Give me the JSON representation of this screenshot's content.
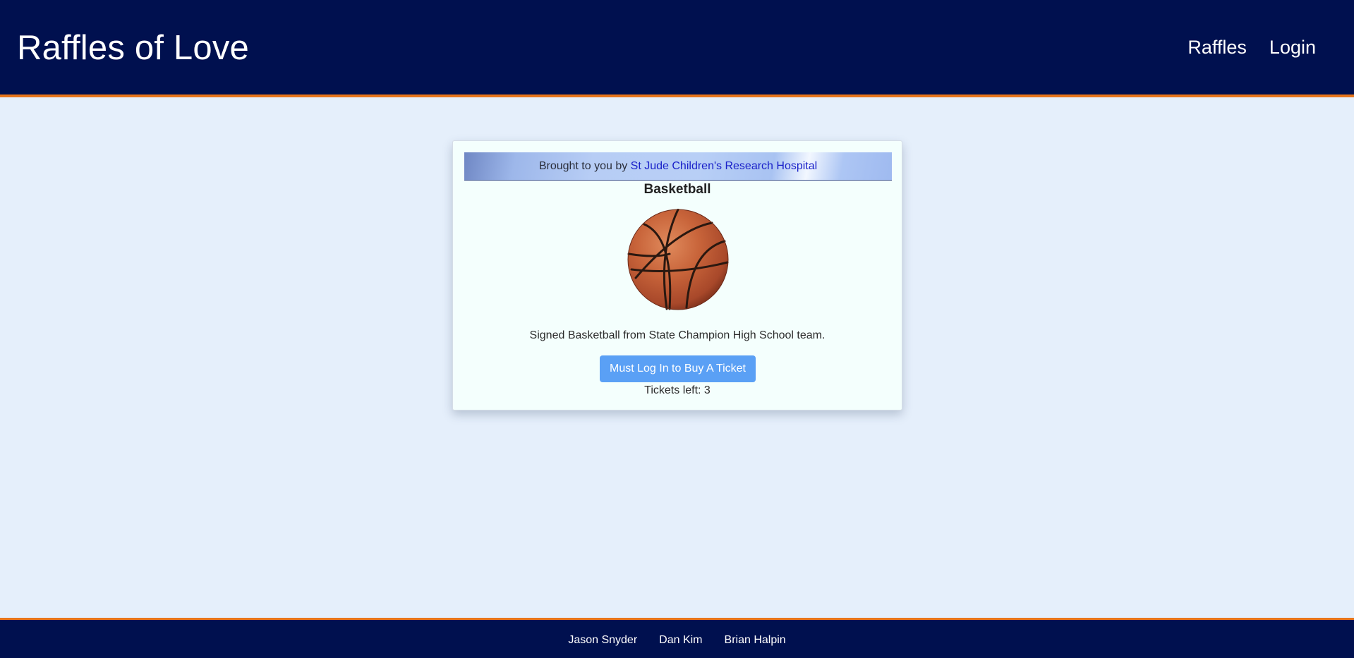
{
  "header": {
    "brand": "Raffles of Love",
    "nav": [
      {
        "label": "Raffles"
      },
      {
        "label": "Login"
      }
    ]
  },
  "raffle": {
    "sponsor_prefix": "Brought to you by ",
    "sponsor_name": "St Jude Children's Research Hospital",
    "title": "Basketball",
    "image_icon": "basketball-image",
    "description": "Signed Basketball from State Champion High School team.",
    "button_label": "Must Log In to Buy A Ticket",
    "tickets_left": "Tickets left: 3"
  },
  "footer": {
    "authors": [
      "Jason Snyder",
      "Dan Kim",
      "Brian Halpin"
    ]
  },
  "colors": {
    "header_bg": "#00104f",
    "accent_orange": "#e8751a",
    "page_bg": "#e5effb",
    "button_bg": "#5aa0f5",
    "link": "#1a21c9"
  }
}
